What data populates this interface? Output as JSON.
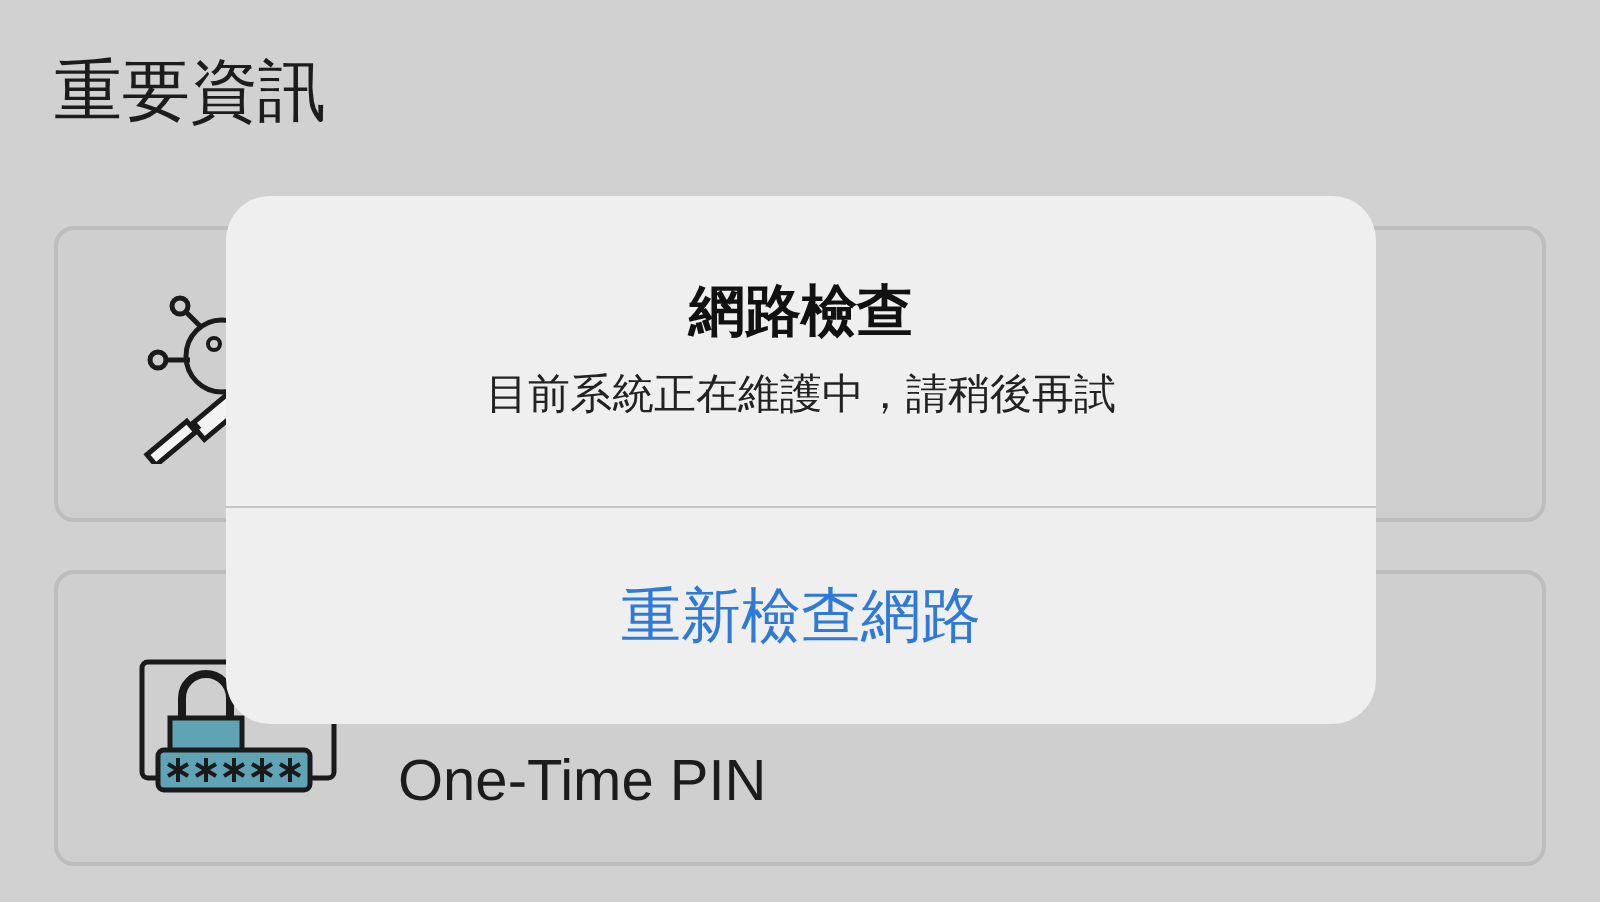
{
  "page": {
    "title": "重要資訊"
  },
  "cards": [
    {
      "kind": "vaccine"
    },
    {
      "kind": "pin",
      "label": "One-Time PIN"
    }
  ],
  "alert": {
    "title": "網路檢查",
    "message": "目前系統正在維護中，請稍後再試",
    "buttons": [
      "重新檢查網路"
    ]
  }
}
